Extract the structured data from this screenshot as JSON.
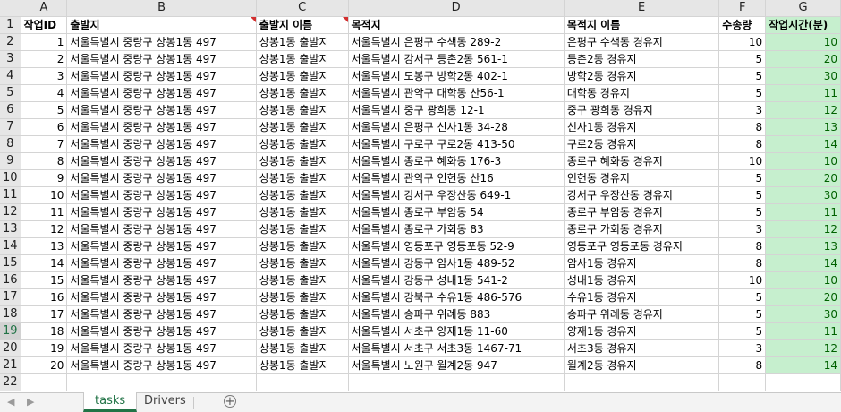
{
  "columns": [
    "A",
    "B",
    "C",
    "D",
    "E",
    "F",
    "G"
  ],
  "headers": [
    "작업ID",
    "출발지",
    "출발지 이름",
    "목적지",
    "목적지 이름",
    "수송량",
    "작업시간(분)"
  ],
  "rows": [
    {
      "id": "1",
      "origin": "서울특별시 중랑구 상봉1동 497",
      "origin_name": "상봉1동 출발지",
      "dest": "서울특별시 은평구 수색동 289-2",
      "dest_name": "은평구 수색동 경유지",
      "qty": "10",
      "time": "10"
    },
    {
      "id": "2",
      "origin": "서울특별시 중랑구 상봉1동 497",
      "origin_name": "상봉1동 출발지",
      "dest": "서울특별시 강서구 등촌2동 561-1",
      "dest_name": "등촌2동 경유지",
      "qty": "5",
      "time": "20"
    },
    {
      "id": "3",
      "origin": "서울특별시 중랑구 상봉1동 497",
      "origin_name": "상봉1동 출발지",
      "dest": "서울특별시 도봉구 방학2동 402-1",
      "dest_name": "방학2동 경유지",
      "qty": "5",
      "time": "30"
    },
    {
      "id": "4",
      "origin": "서울특별시 중랑구 상봉1동 497",
      "origin_name": "상봉1동 출발지",
      "dest": "서울특별시 관악구 대학동 산56-1",
      "dest_name": "대학동 경유지",
      "qty": "5",
      "time": "11"
    },
    {
      "id": "5",
      "origin": "서울특별시 중랑구 상봉1동 497",
      "origin_name": "상봉1동 출발지",
      "dest": "서울특별시 중구 광희동 12-1",
      "dest_name": "중구 광희동 경유지",
      "qty": "3",
      "time": "12"
    },
    {
      "id": "6",
      "origin": "서울특별시 중랑구 상봉1동 497",
      "origin_name": "상봉1동 출발지",
      "dest": "서울특별시 은평구 신사1동 34-28",
      "dest_name": "신사1동 경유지",
      "qty": "8",
      "time": "13"
    },
    {
      "id": "7",
      "origin": "서울특별시 중랑구 상봉1동 497",
      "origin_name": "상봉1동 출발지",
      "dest": "서울특별시 구로구 구로2동 413-50",
      "dest_name": "구로2동 경유지",
      "qty": "8",
      "time": "14"
    },
    {
      "id": "8",
      "origin": "서울특별시 중랑구 상봉1동 497",
      "origin_name": "상봉1동 출발지",
      "dest": "서울특별시 종로구 혜화동 176-3",
      "dest_name": "종로구 혜화동 경유지",
      "qty": "10",
      "time": "10"
    },
    {
      "id": "9",
      "origin": "서울특별시 중랑구 상봉1동 497",
      "origin_name": "상봉1동 출발지",
      "dest": "서울특별시 관악구 인헌동 산16",
      "dest_name": "인헌동 경유지",
      "qty": "5",
      "time": "20"
    },
    {
      "id": "10",
      "origin": "서울특별시 중랑구 상봉1동 497",
      "origin_name": "상봉1동 출발지",
      "dest": "서울특별시 강서구 우장산동 649-1",
      "dest_name": "강서구 우장산동 경유지",
      "qty": "5",
      "time": "30"
    },
    {
      "id": "11",
      "origin": "서울특별시 중랑구 상봉1동 497",
      "origin_name": "상봉1동 출발지",
      "dest": "서울특별시 종로구 부암동 54",
      "dest_name": "종로구 부암동 경유지",
      "qty": "5",
      "time": "11"
    },
    {
      "id": "12",
      "origin": "서울특별시 중랑구 상봉1동 497",
      "origin_name": "상봉1동 출발지",
      "dest": "서울특별시 종로구 가회동 83",
      "dest_name": "종로구 가회동 경유지",
      "qty": "3",
      "time": "12"
    },
    {
      "id": "13",
      "origin": "서울특별시 중랑구 상봉1동 497",
      "origin_name": "상봉1동 출발지",
      "dest": "서울특별시 영등포구 영등포동 52-9",
      "dest_name": "영등포구 영등포동 경유지",
      "qty": "8",
      "time": "13"
    },
    {
      "id": "14",
      "origin": "서울특별시 중랑구 상봉1동 497",
      "origin_name": "상봉1동 출발지",
      "dest": "서울특별시 강동구 암사1동 489-52",
      "dest_name": "암사1동 경유지",
      "qty": "8",
      "time": "14"
    },
    {
      "id": "15",
      "origin": "서울특별시 중랑구 상봉1동 497",
      "origin_name": "상봉1동 출발지",
      "dest": "서울특별시 강동구 성내1동 541-2",
      "dest_name": "성내1동 경유지",
      "qty": "10",
      "time": "10"
    },
    {
      "id": "16",
      "origin": "서울특별시 중랑구 상봉1동 497",
      "origin_name": "상봉1동 출발지",
      "dest": "서울특별시 강북구 수유1동 486-576",
      "dest_name": "수유1동 경유지",
      "qty": "5",
      "time": "20"
    },
    {
      "id": "17",
      "origin": "서울특별시 중랑구 상봉1동 497",
      "origin_name": "상봉1동 출발지",
      "dest": "서울특별시 송파구 위례동 883",
      "dest_name": "송파구 위례동 경유지",
      "qty": "5",
      "time": "30"
    },
    {
      "id": "18",
      "origin": "서울특별시 중랑구 상봉1동 497",
      "origin_name": "상봉1동 출발지",
      "dest": "서울특별시 서초구 양재1동 11-60",
      "dest_name": "양재1동 경유지",
      "qty": "5",
      "time": "11"
    },
    {
      "id": "19",
      "origin": "서울특별시 중랑구 상봉1동 497",
      "origin_name": "상봉1동 출발지",
      "dest": "서울특별시 서초구 서초3동 1467-71",
      "dest_name": "서초3동 경유지",
      "qty": "3",
      "time": "12"
    },
    {
      "id": "20",
      "origin": "서울특별시 중랑구 상봉1동 497",
      "origin_name": "상봉1동 출발지",
      "dest": "서울특별시 노원구 월계2동 947",
      "dest_name": "월계2동 경유지",
      "qty": "8",
      "time": "14"
    }
  ],
  "selected_row": 19,
  "sheet_tabs": [
    {
      "label": "tasks",
      "active": true
    },
    {
      "label": "Drivers",
      "active": false
    }
  ],
  "add_sheet_symbol": "+",
  "nav_arrows": [
    "◀",
    "▶"
  ],
  "colors": {
    "green_fill": "#c6efce",
    "green_text": "#006100",
    "accent": "#217346",
    "comment_marker": "#d32f2f"
  }
}
